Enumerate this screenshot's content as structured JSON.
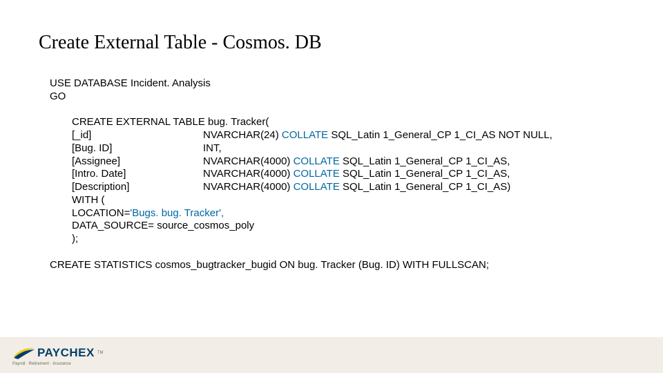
{
  "title": "Create External Table - Cosmos. DB",
  "code": {
    "use_line": "USE DATABASE Incident. Analysis",
    "go_line": "GO",
    "create_line": "CREATE EXTERNAL TABLE bug. Tracker(",
    "cols": [
      {
        "name": "[_id]",
        "type_a": "NVARCHAR(24) ",
        "kw": "COLLATE",
        "type_b": " SQL_Latin 1_General_CP 1_CI_AS NOT NULL,"
      },
      {
        "name": "[Bug. ID]",
        "type_a": "INT,",
        "kw": "",
        "type_b": ""
      },
      {
        "name": "[Assignee]",
        "type_a": "NVARCHAR(4000) ",
        "kw": "COLLATE",
        "type_b": " SQL_Latin 1_General_CP 1_CI_AS,"
      },
      {
        "name": "[Intro. Date]",
        "type_a": "NVARCHAR(4000) ",
        "kw": "COLLATE",
        "type_b": " SQL_Latin 1_General_CP 1_CI_AS,"
      },
      {
        "name": "[Description]",
        "type_a": "NVARCHAR(4000) ",
        "kw": "COLLATE",
        "type_b": " SQL_Latin 1_General_CP 1_CI_AS)"
      }
    ],
    "with_line": "WITH (",
    "loc_a": "LOCATION=",
    "loc_b": "'Bugs. bug. Tracker',",
    "ds_line": "DATA_SOURCE= source_cosmos_poly",
    "close_line": ");",
    "stats_line": "CREATE STATISTICS cosmos_bugtracker_bugid ON bug. Tracker (Bug. ID) WITH FULLSCAN;"
  },
  "logo": {
    "text": "PAYCHEX",
    "tm": "TM",
    "tagline": "Payroll · Retirement · Insurance"
  }
}
